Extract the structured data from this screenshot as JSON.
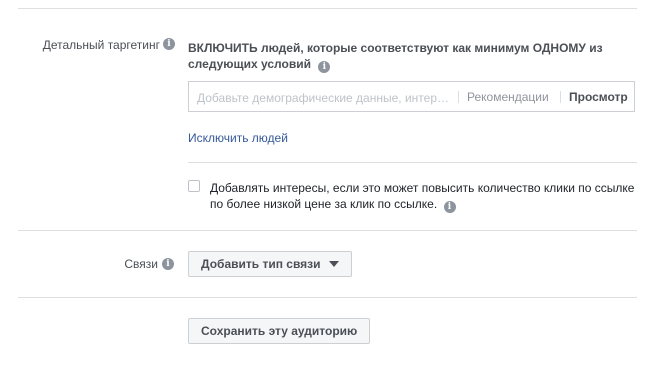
{
  "detailed_targeting": {
    "label": "Детальный таргетинг",
    "include_line1": "ВКЛЮЧИТЬ людей, которые соответствуют как минимум ОДНОМУ из",
    "include_line2": "следующих условий",
    "input_placeholder": "Добавьте демографические данные, интер…",
    "recommendations_label": "Рекомендации",
    "browse_label": "Просмотр",
    "exclude_link": "Исключить людей",
    "expand_line1": "Добавлять интересы, если это может повысить количество клики по ссылке",
    "expand_line2": "по более низкой цене за клик по ссылке."
  },
  "connections": {
    "label": "Связи",
    "add_button": "Добавить тип связи"
  },
  "save_button": "Сохранить эту аудиторию",
  "colors": {
    "link": "#365899",
    "divider": "#dddfe2",
    "label": "#4b4f56",
    "placeholder": "#bec3c9"
  }
}
